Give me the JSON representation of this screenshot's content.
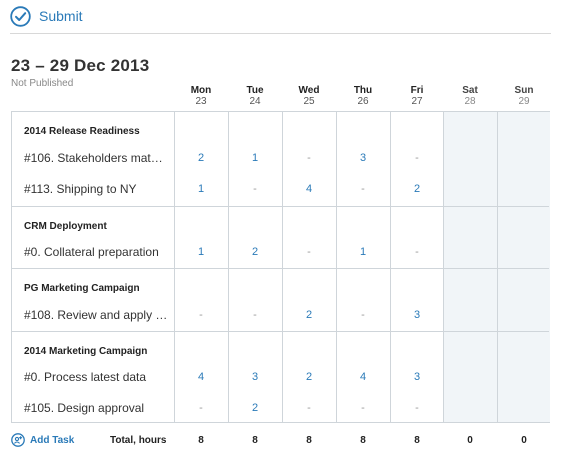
{
  "toolbar": {
    "submit_label": "Submit"
  },
  "header": {
    "week_title": "23 – 29 Dec 2013",
    "status": "Not Published"
  },
  "days": [
    {
      "name": "Mon",
      "num": "23"
    },
    {
      "name": "Tue",
      "num": "24"
    },
    {
      "name": "Wed",
      "num": "25"
    },
    {
      "name": "Thu",
      "num": "26"
    },
    {
      "name": "Fri",
      "num": "27"
    },
    {
      "name": "Sat",
      "num": "28"
    },
    {
      "name": "Sun",
      "num": "29"
    }
  ],
  "groups": [
    {
      "title": "2014 Release Readiness",
      "tasks": [
        {
          "name": "#106. Stakeholders mat…",
          "values": [
            "2",
            "1",
            "-",
            "3",
            "-"
          ]
        },
        {
          "name": "#113. Shipping to NY",
          "values": [
            "1",
            "-",
            "4",
            "-",
            "2"
          ]
        }
      ]
    },
    {
      "title": "CRM Deployment",
      "tasks": [
        {
          "name": "#0. Collateral preparation",
          "values": [
            "1",
            "2",
            "-",
            "1",
            "-"
          ]
        }
      ]
    },
    {
      "title": "PG Marketing Campaign",
      "tasks": [
        {
          "name": "#108. Review and apply …",
          "values": [
            "-",
            "-",
            "2",
            "-",
            "3"
          ]
        }
      ]
    },
    {
      "title": "2014 Marketing Campaign",
      "tasks": [
        {
          "name": "#0. Process latest data",
          "values": [
            "4",
            "3",
            "2",
            "4",
            "3"
          ]
        },
        {
          "name": "#105. Design approval",
          "values": [
            "-",
            "2",
            "-",
            "-",
            "-"
          ]
        }
      ]
    }
  ],
  "footer": {
    "add_task_label": "Add Task",
    "total_label": "Total, hours",
    "totals": [
      "8",
      "8",
      "8",
      "8",
      "8",
      "0",
      "0"
    ]
  },
  "colors": {
    "accent": "#2a7ab8",
    "border": "#cfd5da",
    "weekend_bg": "#f1f5f8"
  }
}
